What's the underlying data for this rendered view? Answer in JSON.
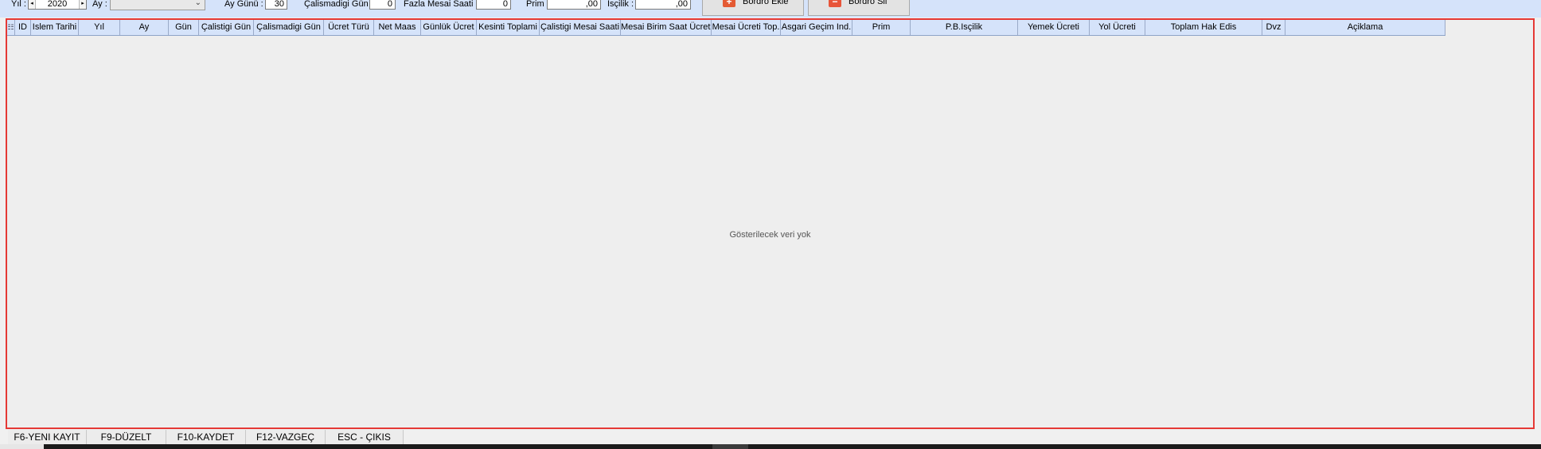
{
  "toolbar": {
    "year_label": "Yıl :",
    "year_value": "2020",
    "month_label": "Ay :",
    "month_value": "",
    "month_days_label": "Ay Günü :",
    "month_days_value": "30",
    "days_not_worked_label": "Çalismadigi Gün :",
    "days_not_worked_value": "0",
    "overtime_hours_label": "Fazla Mesai Saati :",
    "overtime_hours_value": "0",
    "bonus_label": "Prim :",
    "bonus_value": ",00",
    "labor_label": "Isçilik :",
    "labor_value": ",00",
    "add_payroll_label": "Bordro Ekle",
    "delete_payroll_label": "Bordro Sil"
  },
  "grid": {
    "columns": [
      "ID",
      "Islem Tarihi",
      "Yıl",
      "Ay",
      "Gün",
      "Çalistigi Gün",
      "Çalismadigi Gün",
      "Ücret Türü",
      "Net Maas",
      "Günlük Ücret",
      "Kesinti Toplami",
      "Çalistigi Mesai Saati",
      "Mesai Birim Saat Ücreti",
      "Mesai Ücreti Top.",
      "Asgari Geçim Ind.",
      "Prim",
      "P.B.Isçilik",
      "Yemek Ücreti",
      "Yol Ücreti",
      "Toplam Hak Edis",
      "Dvz",
      "Açiklama"
    ],
    "empty_text": "Gösterilecek veri yok"
  },
  "statusbar": {
    "keys": [
      "F6-YENI KAYIT",
      "F9-DÜZELT",
      "F10-KAYDET",
      "F12-VAZGEÇ",
      "ESC - ÇIKIS"
    ]
  },
  "colors": {
    "toolbar_bg": "#d5e3fa",
    "grid_border": "#e53935",
    "header_bg": "#d5e3fa"
  },
  "icons": {
    "add": "plus-icon",
    "delete": "minus-icon",
    "grid_indicator": "column-chooser-icon"
  }
}
